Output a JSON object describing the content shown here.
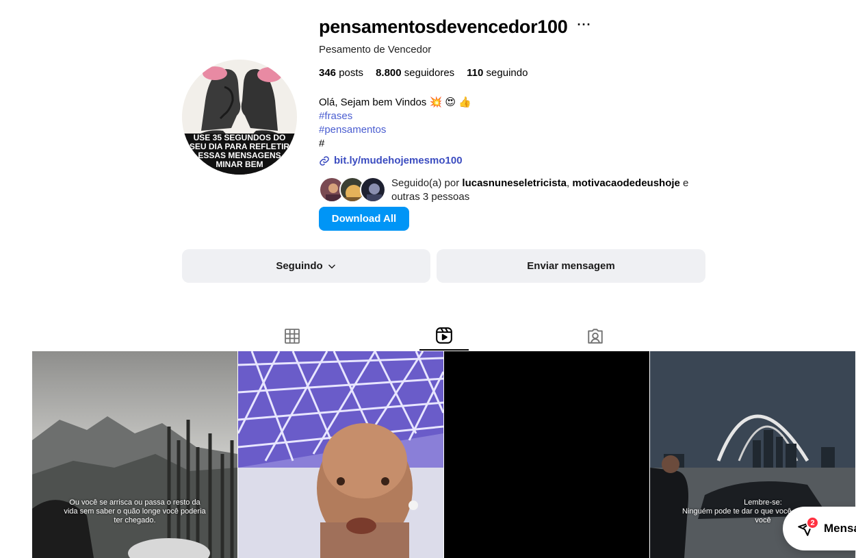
{
  "profile": {
    "username": "pensamentosdevencedor100",
    "more_label": "···",
    "full_name": "Pesamento de Vencedor",
    "avatar_text": [
      "USE 35 SEGUNDOS DO",
      "SEU DIA PARA REFLETIR",
      "ESSAS MENSAGENS",
      "MINAR BEM"
    ]
  },
  "stats": {
    "posts_count": "346",
    "posts_label": "posts",
    "followers_count": "8.800",
    "followers_label": "seguidores",
    "following_count": "110",
    "following_label": "seguindo"
  },
  "bio": {
    "greeting": "Olá, Sejam bem Vindos",
    "emojis": [
      "💥",
      "😍",
      "👍"
    ],
    "tags": [
      "#frases",
      "#pensamentos"
    ],
    "hash_line": "#",
    "link": "bit.ly/mudehojemesmo100"
  },
  "followed_by": {
    "prefix": "Seguido(a) por",
    "user1": "lucasnuneseletricista",
    "separator": ",",
    "user2": "motivacaodedeushoje",
    "conj": "e",
    "suffix": "outras 3 pessoas"
  },
  "buttons": {
    "download": "Download All",
    "following": "Seguindo",
    "message": "Enviar mensagem"
  },
  "tabs": [
    {
      "name": "posts",
      "icon": "grid-icon",
      "active": false
    },
    {
      "name": "reels",
      "icon": "reels-icon",
      "active": true
    },
    {
      "name": "tagged",
      "icon": "tagged-icon",
      "active": false
    }
  ],
  "grid": {
    "tile1_caption": "Ou você se arrisca ou passa o resto da vida sem saber o quão longe você poderia ter chegado.",
    "tile4_caption_title": "Lembre-se:",
    "tile4_caption_body": "Ninguém pode te dar o que você quer, a não ser você"
  },
  "messages_widget": {
    "label": "Mensa",
    "badge": "2"
  },
  "colors": {
    "accent": "#0095f6",
    "link": "#3b4cc0",
    "hashtag": "#4a5dd0",
    "button_bg": "#eff0f3",
    "badge": "#ff3040"
  }
}
